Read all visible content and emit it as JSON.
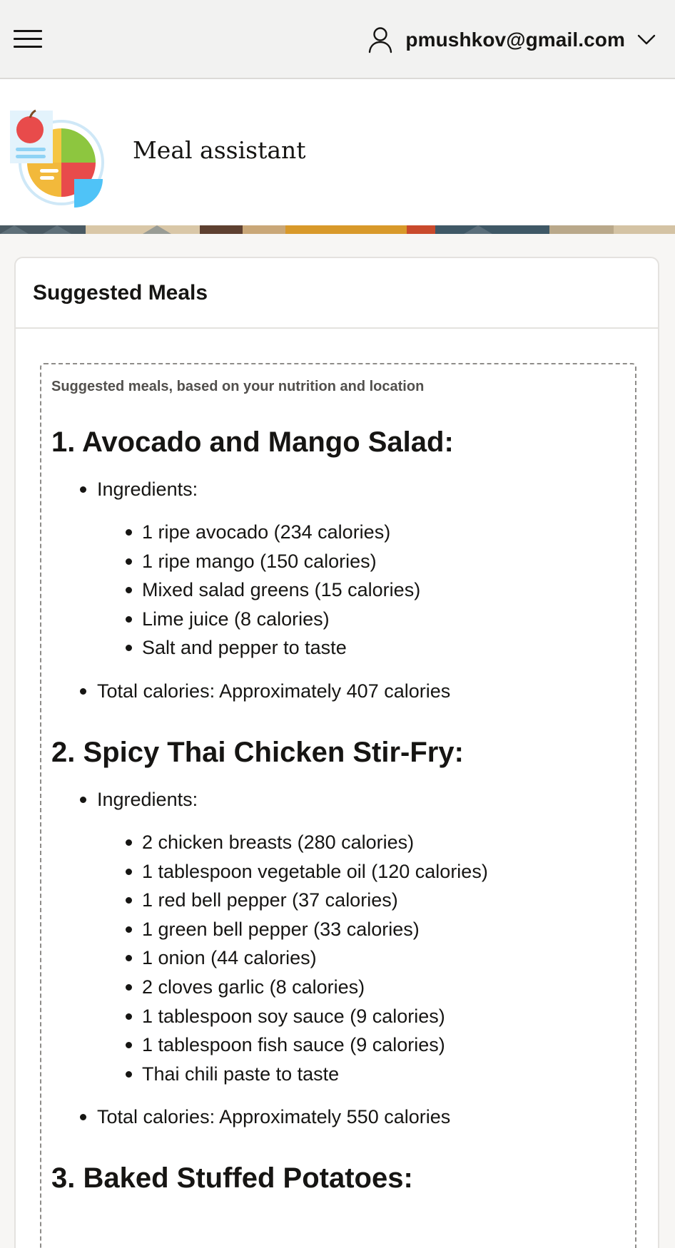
{
  "header": {
    "user_email": "pmushkov@gmail.com"
  },
  "app": {
    "title": "Meal assistant"
  },
  "card": {
    "title": "Suggested Meals",
    "subtitle": "Suggested meals, based on your nutrition and location"
  },
  "meals": [
    {
      "title": "1. Avocado and Mango Salad:",
      "ingredients_label": "Ingredients:",
      "ingredients": [
        "1 ripe avocado (234 calories)",
        "1 ripe mango (150 calories)",
        "Mixed salad greens (15 calories)",
        "Lime juice (8 calories)",
        "Salt and pepper to taste"
      ],
      "total": "Total calories: Approximately 407 calories"
    },
    {
      "title": "2. Spicy Thai Chicken Stir-Fry:",
      "ingredients_label": "Ingredients:",
      "ingredients": [
        "2 chicken breasts (280 calories)",
        "1 tablespoon vegetable oil (120 calories)",
        "1 red bell pepper (37 calories)",
        "1 green bell pepper (33 calories)",
        "1 onion (44 calories)",
        "2 cloves garlic (8 calories)",
        "1 tablespoon soy sauce (9 calories)",
        "1 tablespoon fish sauce (9 calories)",
        "Thai chili paste to taste"
      ],
      "total": "Total calories: Approximately 550 calories"
    },
    {
      "title": "3. Baked Stuffed Potatoes:"
    }
  ],
  "colors": {
    "topbar_bg": "#f2f2f1",
    "page_bg": "#f7f6f4",
    "text": "#161513",
    "muted": "#52504d"
  }
}
